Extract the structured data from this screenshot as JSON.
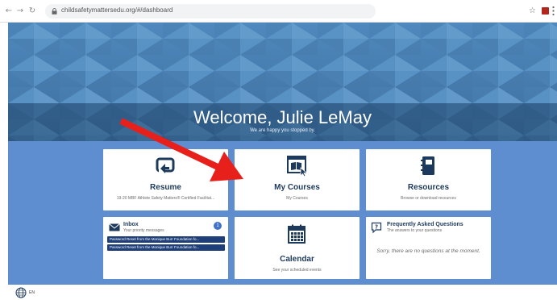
{
  "browser": {
    "url": "childsafetymattersedu.org/#/dashboard",
    "icons": {
      "back": "back-arrow-icon",
      "forward": "forward-arrow-icon",
      "reload": "reload-icon",
      "lock": "lock-icon",
      "bookmark": "star-icon",
      "menu": "more-menu-icon"
    }
  },
  "hero": {
    "title": "Welcome, Julie LeMay",
    "subtitle": "We are happy you stopped by."
  },
  "cards": {
    "resume": {
      "title": "Resume",
      "subtitle": "19-20 MBF Athlete Safety Matters® Certified Facilitat...",
      "icon": "resume-return-icon"
    },
    "my_courses": {
      "title": "My Courses",
      "subtitle": "My Courses",
      "icon": "courses-window-icon"
    },
    "resources": {
      "title": "Resources",
      "subtitle": "Browse or download resources",
      "icon": "notebook-icon"
    },
    "inbox": {
      "title": "Inbox",
      "subtitle": "Your priority messages",
      "count": "1",
      "messages": [
        "Password Reset from the Monique Burr Foundation fo...",
        "Password Reset from the Monique Burr Foundation fo..."
      ],
      "icon": "envelope-icon"
    },
    "calendar": {
      "title": "Calendar",
      "subtitle": "See your scheduled events",
      "icon": "calendar-icon"
    },
    "faq": {
      "title": "Frequently Asked Questions",
      "subtitle": "The answers to your questions",
      "empty_text": "Sorry, there are no questions at the moment.",
      "icon": "question-bubble-icon"
    }
  },
  "footer": {
    "language": "EN",
    "icon": "globe-icon"
  },
  "colors": {
    "hero_blue": "#4a7fb0",
    "main_blue": "#5e8ed0",
    "title_navy": "#1d3a5c",
    "message_bar": "#1f3f7a",
    "annotation_arrow": "#e8201c"
  }
}
